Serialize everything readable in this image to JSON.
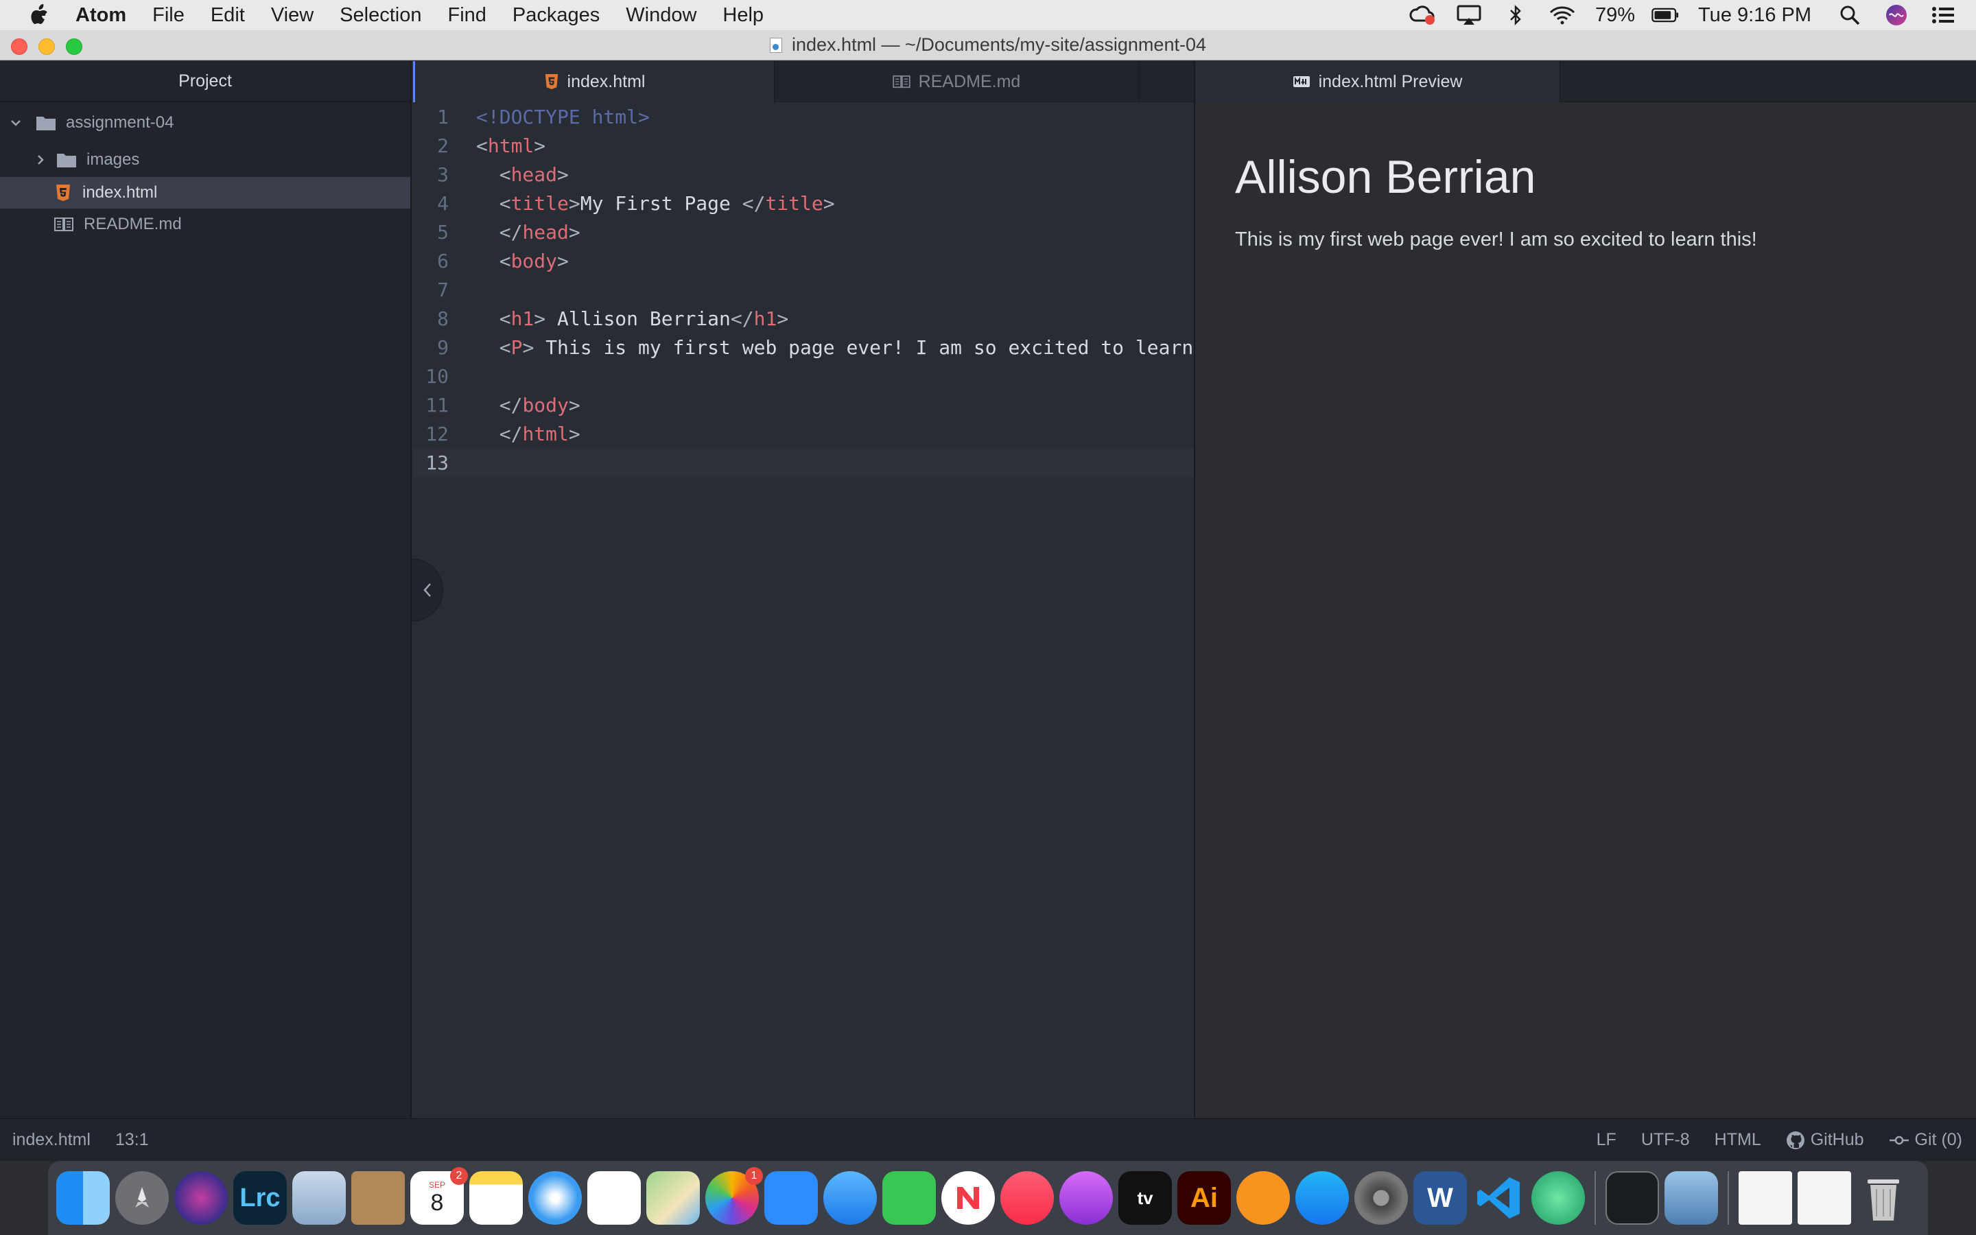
{
  "menubar": {
    "app_name": "Atom",
    "items": [
      "File",
      "Edit",
      "View",
      "Selection",
      "Find",
      "Packages",
      "Window",
      "Help"
    ],
    "battery": "79%",
    "clock": "Tue 9:16 PM"
  },
  "titlebar": {
    "title": "index.html — ~/Documents/my-site/assignment-04"
  },
  "tree": {
    "header": "Project",
    "root": "assignment-04",
    "folder": "images",
    "files": [
      "index.html",
      "README.md"
    ]
  },
  "editor": {
    "tabs": [
      "index.html",
      "README.md"
    ],
    "lines": [
      "<!DOCTYPE html>",
      "<html>",
      "  <head>",
      "  <title>My First Page </title>",
      "  </head>",
      "  <body>",
      "",
      "  <h1> Allison Berrian</h1>",
      "  <P> This is my first web page ever! I am so excited to learn",
      "",
      "  </body>",
      "  </html>",
      ""
    ],
    "line_numbers": [
      "1",
      "2",
      "3",
      "4",
      "5",
      "6",
      "7",
      "8",
      "9",
      "10",
      "11",
      "12",
      "13"
    ]
  },
  "preview": {
    "tab": "index.html Preview",
    "heading": "Allison Berrian",
    "paragraph": "This is my first web page ever! I am so excited to learn this!"
  },
  "statusbar": {
    "file": "index.html",
    "cursor": "13:1",
    "line_ending": "LF",
    "encoding": "UTF-8",
    "grammar": "HTML",
    "github": "GitHub",
    "git": "Git (0)"
  },
  "dock": {
    "calendar_month": "SEP",
    "calendar_day": "8",
    "calendar_badge": "2",
    "photos_badge": "1",
    "lightroom_label": "Lrc",
    "illustrator_label": "Ai",
    "word_label": "W",
    "tv_label": "tv"
  },
  "colors": {
    "accent": "#568af2",
    "tag": "#e06c75",
    "doctype": "#5c6ba8",
    "editor_bg": "#282c34"
  }
}
